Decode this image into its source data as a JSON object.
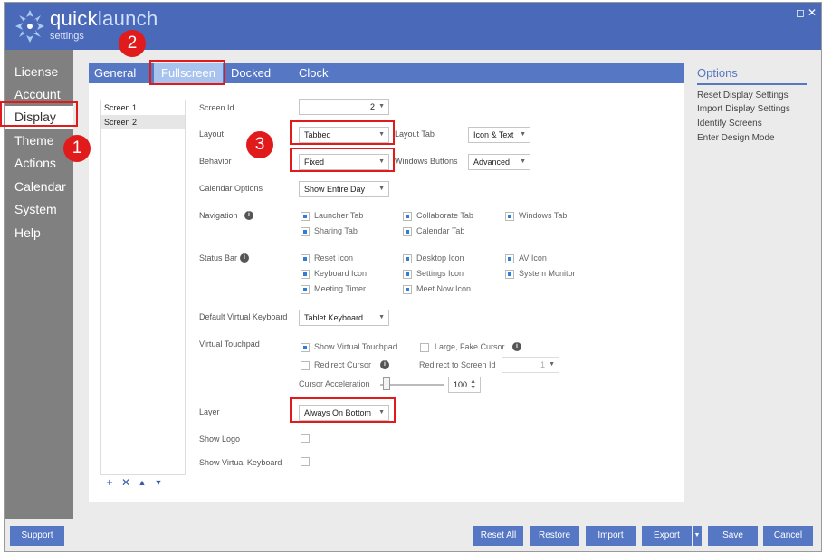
{
  "app": {
    "brand_part1": "quick",
    "brand_part2": "launch",
    "subtitle": "settings"
  },
  "window_controls": {
    "restore": "◻",
    "close": "✕"
  },
  "sidebar": {
    "items": [
      "License",
      "Account",
      "Display",
      "Theme",
      "Actions",
      "Calendar",
      "System",
      "Help"
    ],
    "active": "Display"
  },
  "tabs": [
    "General",
    "Fullscreen",
    "Docked",
    "Clock"
  ],
  "active_tab": "Fullscreen",
  "screens": [
    "Screen 1",
    "Screen 2"
  ],
  "selected_screen": "Screen 2",
  "list_tools": {
    "add": "+",
    "remove": "✕",
    "up": "▲",
    "down": "▼"
  },
  "form": {
    "screen_id": {
      "label": "Screen Id",
      "value": "2"
    },
    "layout": {
      "label": "Layout",
      "value": "Tabbed"
    },
    "layout_tab": {
      "label": "Layout Tab",
      "value": "Icon & Text"
    },
    "behavior": {
      "label": "Behavior",
      "value": "Fixed"
    },
    "windows_buttons": {
      "label": "Windows Buttons",
      "value": "Advanced"
    },
    "calendar_options": {
      "label": "Calendar Options",
      "value": "Show Entire Day"
    },
    "navigation": {
      "label": "Navigation",
      "items": [
        {
          "label": "Launcher Tab",
          "checked": true
        },
        {
          "label": "Collaborate Tab",
          "checked": true
        },
        {
          "label": "Windows Tab",
          "checked": true
        },
        {
          "label": "Sharing Tab",
          "checked": true
        },
        {
          "label": "Calendar Tab",
          "checked": true
        }
      ]
    },
    "status_bar": {
      "label": "Status Bar",
      "items": [
        {
          "label": "Reset Icon",
          "checked": true
        },
        {
          "label": "Desktop Icon",
          "checked": true
        },
        {
          "label": "AV Icon",
          "checked": true
        },
        {
          "label": "Keyboard Icon",
          "checked": true
        },
        {
          "label": "Settings Icon",
          "checked": true
        },
        {
          "label": "System Monitor",
          "checked": true
        },
        {
          "label": "Meeting Timer",
          "checked": true
        },
        {
          "label": "Meet Now Icon",
          "checked": true
        }
      ]
    },
    "default_keyboard": {
      "label": "Default Virtual Keyboard",
      "value": "Tablet Keyboard"
    },
    "virtual_touchpad": {
      "label": "Virtual Touchpad",
      "show": {
        "label": "Show Virtual Touchpad",
        "checked": true
      },
      "large_cursor": {
        "label": "Large, Fake Cursor",
        "checked": false
      },
      "redirect": {
        "label": "Redirect Cursor",
        "checked": false
      },
      "redirect_screen": {
        "label": "Redirect to Screen Id",
        "value": "1"
      },
      "acceleration": {
        "label": "Cursor Acceleration",
        "value": "100",
        "level": 0.05
      }
    },
    "layer": {
      "label": "Layer",
      "value": "Always On Bottom"
    },
    "show_logo": {
      "label": "Show Logo",
      "checked": false
    },
    "show_keyboard": {
      "label": "Show Virtual Keyboard",
      "checked": false
    }
  },
  "options": {
    "title": "Options",
    "items": [
      "Reset Display Settings",
      "Import Display Settings",
      "Identify Screens",
      "Enter Design Mode"
    ]
  },
  "footer": {
    "support": "Support",
    "reset_all": "Reset All",
    "restore": "Restore",
    "import": "Import",
    "export": "Export",
    "save": "Save",
    "cancel": "Cancel"
  },
  "annotations": [
    "1",
    "2",
    "3"
  ],
  "colors": {
    "accent": "#5677c4",
    "titlebar": "#4a69b8",
    "sidebar": "#808080",
    "annotation": "#e11b1b",
    "checkbox": "#2f7fd9"
  }
}
